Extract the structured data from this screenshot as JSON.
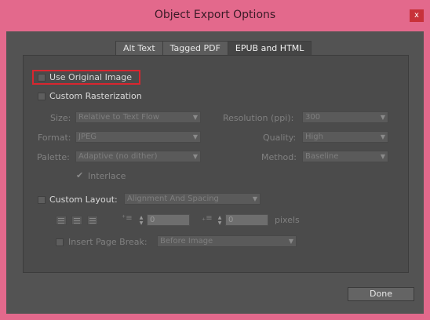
{
  "window": {
    "title": "Object Export Options",
    "close_glyph": "x"
  },
  "tabs": [
    {
      "label": "Alt Text"
    },
    {
      "label": "Tagged PDF"
    },
    {
      "label": "EPUB and HTML"
    }
  ],
  "options": {
    "use_original_image": {
      "label": "Use Original Image",
      "checked": false
    },
    "custom_rasterization": {
      "label": "Custom Rasterization",
      "checked": false
    },
    "size": {
      "label": "Size:",
      "value": "Relative to Text Flow"
    },
    "format": {
      "label": "Format:",
      "value": "JPEG"
    },
    "palette": {
      "label": "Palette:",
      "value": "Adaptive (no dither)"
    },
    "resolution": {
      "label": "Resolution (ppi):",
      "value": "300"
    },
    "quality": {
      "label": "Quality:",
      "value": "High"
    },
    "method": {
      "label": "Method:",
      "value": "Baseline"
    },
    "interlace": {
      "label": "Interlace",
      "checked": true
    },
    "custom_layout": {
      "label": "Custom Layout:",
      "checked": false,
      "value": "Alignment And Spacing"
    },
    "spacing_before": {
      "value": "0"
    },
    "spacing_after": {
      "value": "0"
    },
    "spacing_unit": "pixels",
    "insert_page_break": {
      "label": "Insert Page Break:",
      "checked": false,
      "value": "Before Image"
    }
  },
  "footer": {
    "done_label": "Done"
  },
  "colors": {
    "window_frame": "#e3698c",
    "dialog_bg": "#535353",
    "highlight": "#d9262f"
  }
}
